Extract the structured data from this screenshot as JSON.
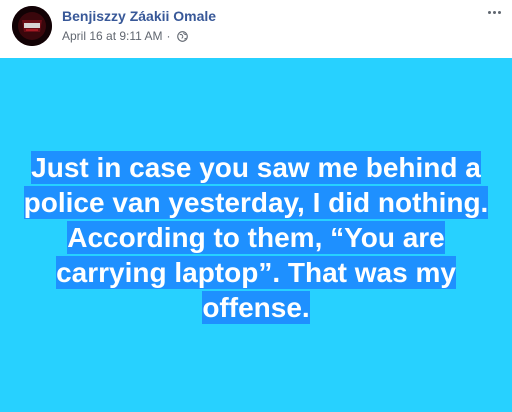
{
  "post": {
    "author": "Benjiszzy Záakii Omale",
    "timestamp": "April 16 at 9:11 AM",
    "separator": "·",
    "privacy_icon": "globe-icon",
    "more_icon": "more-options-icon",
    "status_text": "Just in case you saw me behind a police van yesterday, I did nothing. According to them, “You are carrying laptop”. That was my offense.",
    "background_color": "#27d1ff",
    "highlight_color": "#1e90ff",
    "author_color": "#385898"
  }
}
